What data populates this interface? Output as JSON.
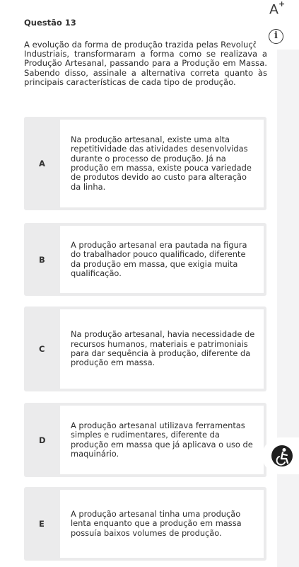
{
  "question": {
    "title": "Questão 13",
    "statement": "A evolução da forma de produção trazida pelas Revoluções Industriais, transformaram a forma como se realizava a Produção Artesanal, passando para a Produção em Massa. Sabendo disso, assinale a alternativa correta quanto às principais características de cada tipo de produção."
  },
  "options": [
    {
      "letter": "A",
      "text": "Na produção artesanal, existe uma alta repetitividade das atividades desenvolvidas durante o processo de produção. Já na produção em massa, existe pouca variedade de produtos devido ao custo para alteração da linha."
    },
    {
      "letter": "B",
      "text": "A produção artesanal era pautada na figura do trabalhador pouco qualificado, diferente da produção em massa, que exigia muita qualificação."
    },
    {
      "letter": "C",
      "text": "Na produção artesanal, havia necessidade de recursos humanos, materiais e patrimoniais para dar sequência à produção, diferente da produção em massa."
    },
    {
      "letter": "D",
      "text": "A produção artesanal utilizava ferramentas simples e rudimentares, diferente da produção em massa que já aplicava o uso de maquinário."
    },
    {
      "letter": "E",
      "text": "A produção artesanal tinha uma produção lenta enquanto que a produção em massa possuía baixos volumes de produção."
    }
  ],
  "toolbar": {
    "font_size_label": "A",
    "font_size_sup": "+",
    "info_label": "i"
  },
  "icons": {
    "font": "font-size-increase-icon",
    "info": "info-icon",
    "accessibility": "accessibility-icon"
  },
  "colors": {
    "option_background": "#ebebec",
    "page_background": "#ffffff",
    "accessibility_button": "#1f1f1f"
  }
}
